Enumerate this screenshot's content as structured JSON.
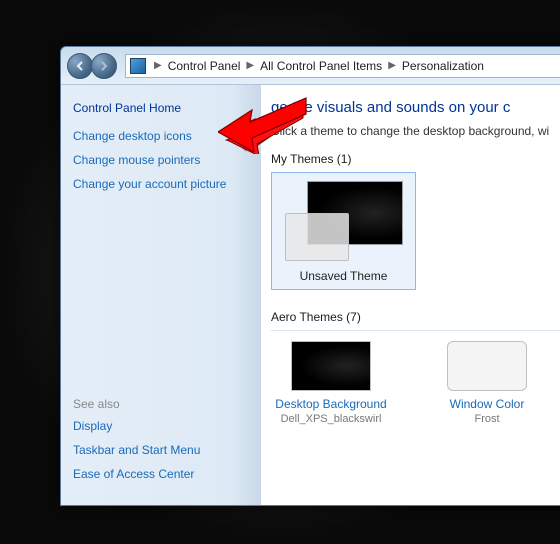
{
  "breadcrumb": {
    "items": [
      "Control Panel",
      "All Control Panel Items",
      "Personalization"
    ]
  },
  "sidebar": {
    "title": "Control Panel Home",
    "links": [
      "Change desktop icons",
      "Change mouse pointers",
      "Change your account picture"
    ],
    "seeAlso": {
      "header": "See also",
      "links": [
        "Display",
        "Taskbar and Start Menu",
        "Ease of Access Center"
      ]
    }
  },
  "main": {
    "heading": "ge the visuals and sounds on your c",
    "instruction": "Click a theme to change the desktop background, wi",
    "myThemes": {
      "header": "My Themes (1)",
      "item": "Unsaved Theme"
    },
    "aeroThemes": {
      "header": "Aero Themes (7)"
    },
    "ops": {
      "bg": {
        "label": "Desktop Background",
        "sub": "Dell_XPS_blackswirl"
      },
      "color": {
        "label": "Window Color",
        "sub": "Frost"
      }
    }
  }
}
